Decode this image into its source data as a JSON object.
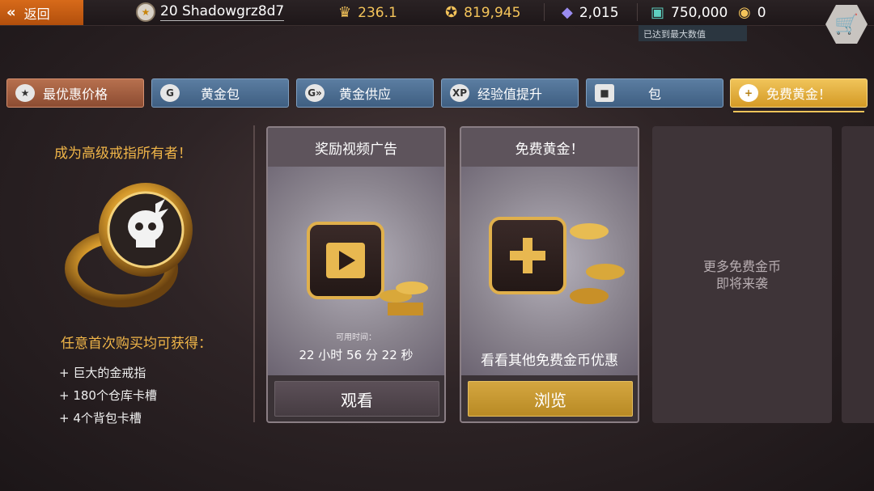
{
  "topbar": {
    "back_label": "返回",
    "player_level": "20",
    "player_name": "Shadowgrz8d7",
    "stat1": "236.1",
    "stat2": "819,945",
    "stat3": "2,015",
    "stat4": "750,000",
    "stat5": "0",
    "tooltip": "已达到最大数值"
  },
  "tabs": [
    {
      "label": "最优惠价格",
      "icon": "star-icon"
    },
    {
      "label": "黄金包",
      "icon": "gold-g-icon"
    },
    {
      "label": "黄金供应",
      "icon": "gold-supply-icon"
    },
    {
      "label": "经验值提升",
      "icon": "xp-icon"
    },
    {
      "label": "包",
      "icon": "box-icon"
    },
    {
      "label": "免费黄金！",
      "icon": "plus-icon"
    }
  ],
  "promo": {
    "title": "成为高级戒指所有者！",
    "subtitle": "任意首次购买均可获得：",
    "perks": [
      "+ 巨大的金戒指",
      "+ 180个仓库卡槽",
      "+ 4个背包卡槽"
    ]
  },
  "cards": {
    "video": {
      "title": "奖励视频广告",
      "timer_label": "可用时间：",
      "timer": "22 小时 56 分 22 秒",
      "button": "观看"
    },
    "free": {
      "title": "免费黄金！",
      "desc": "看看其他免费金币优惠",
      "button": "浏览"
    },
    "coming": {
      "line1": "更多免费金币",
      "line2": "即将来袭"
    }
  },
  "colors": {
    "accent_gold": "#f0b548",
    "tab_blue": "#4f6f92",
    "back_orange": "#d2641a"
  }
}
